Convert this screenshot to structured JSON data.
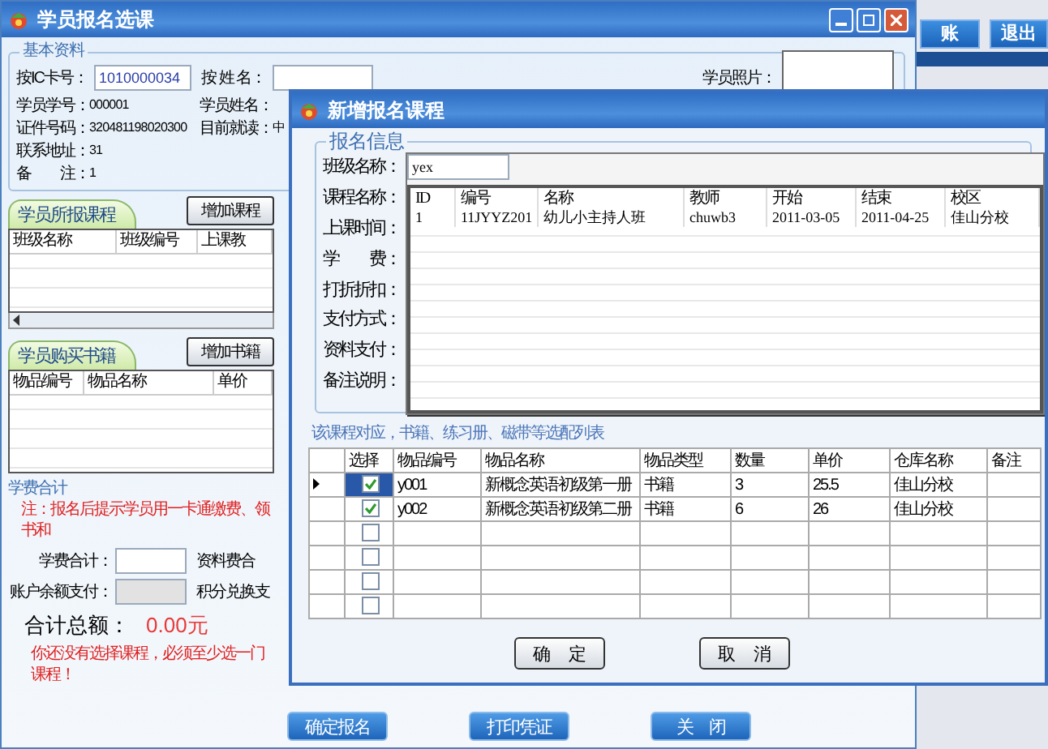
{
  "main_window": {
    "title": "学员报名选课",
    "basic_info": {
      "legend": "基本资料",
      "ic_label": "按IC卡号：",
      "ic_value": "1010000034",
      "name_label": "按 姓 名：",
      "photo_label": "学员照片：",
      "rows": [
        [
          {
            "label": "学员学号：",
            "value": "000001"
          },
          {
            "label": "学员姓名："
          }
        ],
        [
          {
            "label": "证件号码：",
            "value": "320481198020300"
          },
          {
            "label": "目前就读：",
            "value": "中"
          }
        ],
        [
          {
            "label": "联系地址：",
            "value": "31"
          }
        ],
        [
          {
            "label": "备　　注：",
            "value": "1"
          }
        ]
      ]
    },
    "courses": {
      "tab": "学员所报课程",
      "add_button": "增加课程",
      "columns": [
        "班级名称",
        "班级编号",
        "上课教"
      ]
    },
    "books": {
      "tab": "学员购买书籍",
      "add_button": "增加书籍",
      "columns": [
        "物品编号",
        "物品名称",
        "单价"
      ]
    },
    "fees": {
      "legend": "学费合计",
      "note": "注：报名后提示学员用一卡通缴费、领书和",
      "rows": [
        {
          "label": "学费合计：",
          "disabled": false,
          "side_label": "资料费合"
        },
        {
          "label": "账户余额支付：",
          "disabled": true,
          "side_label": "积分兑换支"
        }
      ],
      "total_label": "合计总额：",
      "total_value": "0.00元",
      "warning": "你还没有选择课程，必须至少选一门课程！"
    },
    "buttons": [
      "确定报名",
      "打印凭证",
      "关　闭"
    ]
  },
  "side_toolbar": {
    "buttons": [
      "账",
      "退出"
    ]
  },
  "dialog": {
    "title": "新增报名课程",
    "legend": "报名信息",
    "labels": [
      "班级名称：",
      "课程名称：",
      "上课时间：",
      "学　　费：",
      "打折折扣：",
      "支付方式：",
      "资料支付：",
      "备注说明："
    ],
    "class_input": "yex",
    "dropdown": {
      "columns": [
        "ID",
        "编号",
        "名称",
        "教师",
        "开始",
        "结束",
        "校区"
      ],
      "rows": [
        [
          "1",
          "11JYYZ201",
          "幼儿小主持人班",
          "chuwb3",
          "2011-03-05",
          "2011-04-25",
          "佳山分校"
        ]
      ]
    },
    "items_caption": "该课程对应，书籍、练习册、磁带等选配列表",
    "items": {
      "columns": [
        "选择",
        "物品编号",
        "物品名称",
        "物品类型",
        "数量",
        "单价",
        "仓库名称",
        "备注"
      ],
      "rows": [
        {
          "selected": true,
          "checked": true,
          "cells": [
            "y001",
            "新概念英语初级第一册",
            "书籍",
            "3",
            "25.5",
            "佳山分校"
          ]
        },
        {
          "selected": false,
          "checked": true,
          "cells": [
            "y002",
            "新概念英语初级第二册",
            "书籍",
            "6",
            "26",
            "佳山分校"
          ]
        },
        {
          "selected": false,
          "checked": false
        },
        {
          "selected": false,
          "checked": false
        },
        {
          "selected": false,
          "checked": false
        },
        {
          "selected": false,
          "checked": false
        }
      ]
    },
    "buttons": [
      "确　定",
      "取　消"
    ]
  }
}
